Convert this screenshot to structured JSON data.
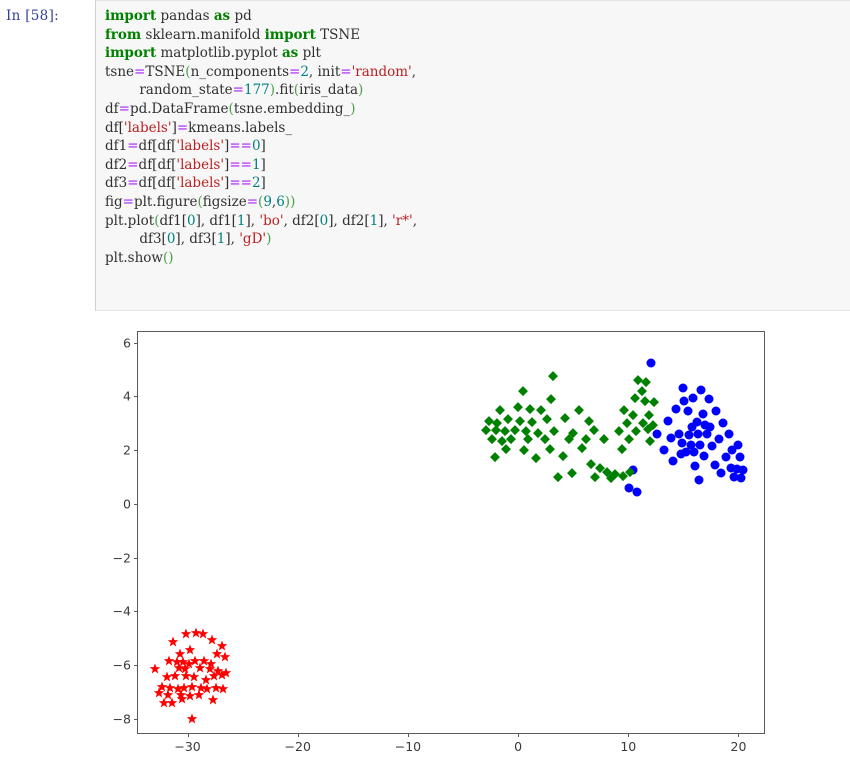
{
  "notebook": {
    "prompt": "In [58]:",
    "cell_type": "code",
    "code_lines": [
      [
        {
          "t": "import",
          "c": "kw"
        },
        {
          "t": " pandas ",
          "c": "pln"
        },
        {
          "t": "as",
          "c": "kw"
        },
        {
          "t": " pd",
          "c": "pln"
        }
      ],
      [
        {
          "t": "from",
          "c": "kw"
        },
        {
          "t": " sklearn.manifold ",
          "c": "pln"
        },
        {
          "t": "import",
          "c": "kw"
        },
        {
          "t": " TSNE",
          "c": "pln"
        }
      ],
      [
        {
          "t": "import",
          "c": "kw"
        },
        {
          "t": " matplotlib.pyplot ",
          "c": "pln"
        },
        {
          "t": "as",
          "c": "kw"
        },
        {
          "t": " plt",
          "c": "pln"
        }
      ],
      [
        {
          "t": "tsne",
          "c": "pln"
        },
        {
          "t": "=",
          "c": "op"
        },
        {
          "t": "TSNE",
          "c": "pln"
        },
        {
          "t": "(",
          "c": "par"
        },
        {
          "t": "n_components",
          "c": "pln"
        },
        {
          "t": "=",
          "c": "op"
        },
        {
          "t": "2",
          "c": "num"
        },
        {
          "t": ", init",
          "c": "pln"
        },
        {
          "t": "=",
          "c": "op"
        },
        {
          "t": "'random'",
          "c": "str"
        },
        {
          "t": ",",
          "c": "pln"
        }
      ],
      [
        {
          "t": "        random_state",
          "c": "pln"
        },
        {
          "t": "=",
          "c": "op"
        },
        {
          "t": "177",
          "c": "num"
        },
        {
          "t": ")",
          "c": "par"
        },
        {
          "t": ".fit",
          "c": "pln"
        },
        {
          "t": "(",
          "c": "par"
        },
        {
          "t": "iris_data",
          "c": "pln"
        },
        {
          "t": ")",
          "c": "par"
        }
      ],
      [
        {
          "t": "df",
          "c": "pln"
        },
        {
          "t": "=",
          "c": "op"
        },
        {
          "t": "pd.DataFrame",
          "c": "pln"
        },
        {
          "t": "(",
          "c": "par"
        },
        {
          "t": "tsne.embedding_",
          "c": "pln"
        },
        {
          "t": ")",
          "c": "par"
        }
      ],
      [
        {
          "t": "df[",
          "c": "pln"
        },
        {
          "t": "'labels'",
          "c": "str"
        },
        {
          "t": "]",
          "c": "pln"
        },
        {
          "t": "=",
          "c": "op"
        },
        {
          "t": "kmeans.labels_",
          "c": "pln"
        }
      ],
      [
        {
          "t": "df1",
          "c": "pln"
        },
        {
          "t": "=",
          "c": "op"
        },
        {
          "t": "df[df[",
          "c": "pln"
        },
        {
          "t": "'labels'",
          "c": "str"
        },
        {
          "t": "]",
          "c": "pln"
        },
        {
          "t": "==",
          "c": "op"
        },
        {
          "t": "0",
          "c": "num"
        },
        {
          "t": "]",
          "c": "pln"
        }
      ],
      [
        {
          "t": "df2",
          "c": "pln"
        },
        {
          "t": "=",
          "c": "op"
        },
        {
          "t": "df[df[",
          "c": "pln"
        },
        {
          "t": "'labels'",
          "c": "str"
        },
        {
          "t": "]",
          "c": "pln"
        },
        {
          "t": "==",
          "c": "op"
        },
        {
          "t": "1",
          "c": "num"
        },
        {
          "t": "]",
          "c": "pln"
        }
      ],
      [
        {
          "t": "df3",
          "c": "pln"
        },
        {
          "t": "=",
          "c": "op"
        },
        {
          "t": "df[df[",
          "c": "pln"
        },
        {
          "t": "'labels'",
          "c": "str"
        },
        {
          "t": "]",
          "c": "pln"
        },
        {
          "t": "==",
          "c": "op"
        },
        {
          "t": "2",
          "c": "num"
        },
        {
          "t": "]",
          "c": "pln"
        }
      ],
      [
        {
          "t": "fig",
          "c": "pln"
        },
        {
          "t": "=",
          "c": "op"
        },
        {
          "t": "plt.figure",
          "c": "pln"
        },
        {
          "t": "(",
          "c": "par"
        },
        {
          "t": "figsize",
          "c": "pln"
        },
        {
          "t": "=",
          "c": "op"
        },
        {
          "t": "(",
          "c": "par"
        },
        {
          "t": "9",
          "c": "num"
        },
        {
          "t": ",",
          "c": "pln"
        },
        {
          "t": "6",
          "c": "num"
        },
        {
          "t": ")",
          "c": "par"
        },
        {
          "t": ")",
          "c": "par"
        }
      ],
      [
        {
          "t": "plt.plot",
          "c": "pln"
        },
        {
          "t": "(",
          "c": "par"
        },
        {
          "t": "df1[",
          "c": "pln"
        },
        {
          "t": "0",
          "c": "num"
        },
        {
          "t": "], df1[",
          "c": "pln"
        },
        {
          "t": "1",
          "c": "num"
        },
        {
          "t": "], ",
          "c": "pln"
        },
        {
          "t": "'bo'",
          "c": "str"
        },
        {
          "t": ", df2[",
          "c": "pln"
        },
        {
          "t": "0",
          "c": "num"
        },
        {
          "t": "], df2[",
          "c": "pln"
        },
        {
          "t": "1",
          "c": "num"
        },
        {
          "t": "], ",
          "c": "pln"
        },
        {
          "t": "'r*'",
          "c": "str"
        },
        {
          "t": ",",
          "c": "pln"
        }
      ],
      [
        {
          "t": "        df3[",
          "c": "pln"
        },
        {
          "t": "0",
          "c": "num"
        },
        {
          "t": "], df3[",
          "c": "pln"
        },
        {
          "t": "1",
          "c": "num"
        },
        {
          "t": "], ",
          "c": "pln"
        },
        {
          "t": "'gD'",
          "c": "str"
        },
        {
          "t": ")",
          "c": "par"
        }
      ],
      [
        {
          "t": "plt.show",
          "c": "pln"
        },
        {
          "t": "(",
          "c": "par"
        },
        {
          "t": ")",
          "c": "par"
        }
      ]
    ]
  },
  "chart_data": {
    "type": "scatter",
    "title": "",
    "xlabel": "",
    "ylabel": "",
    "xlim": [
      -34.5,
      22.5
    ],
    "ylim": [
      -8.6,
      6.4
    ],
    "xticks": [
      -30,
      -20,
      -10,
      0,
      10,
      20
    ],
    "yticks": [
      -8,
      -6,
      -4,
      -2,
      0,
      2,
      4,
      6
    ],
    "xticklabels": [
      "−30",
      "−20",
      "−10",
      "0",
      "10",
      "20"
    ],
    "yticklabels": [
      "−8",
      "−6",
      "−4",
      "−2",
      "0",
      "2",
      "4",
      "6"
    ],
    "grid": false,
    "legend": null,
    "series": [
      {
        "name": "df1",
        "marker": "o",
        "marker_label": "bo",
        "color": "#0000FF",
        "size": 9,
        "points": [
          [
            12.1,
            5.25
          ],
          [
            15.0,
            4.3
          ],
          [
            16.6,
            4.25
          ],
          [
            15.9,
            3.95
          ],
          [
            17.3,
            3.9
          ],
          [
            14.3,
            3.55
          ],
          [
            15.4,
            3.45
          ],
          [
            18.0,
            3.45
          ],
          [
            13.6,
            3.1
          ],
          [
            16.2,
            3.05
          ],
          [
            17.0,
            2.95
          ],
          [
            16.8,
            3.35
          ],
          [
            12.6,
            2.6
          ],
          [
            14.6,
            2.6
          ],
          [
            15.5,
            2.55
          ],
          [
            16.3,
            2.6
          ],
          [
            17.1,
            2.6
          ],
          [
            19.1,
            2.6
          ],
          [
            14.9,
            2.25
          ],
          [
            15.7,
            2.2
          ],
          [
            16.5,
            2.2
          ],
          [
            15.2,
            1.95
          ],
          [
            16.0,
            1.95
          ],
          [
            17.6,
            2.15
          ],
          [
            18.9,
            1.75
          ],
          [
            20.1,
            1.75
          ],
          [
            14.1,
            1.6
          ],
          [
            17.9,
            1.45
          ],
          [
            19.3,
            1.35
          ],
          [
            19.9,
            1.3
          ],
          [
            20.4,
            1.25
          ],
          [
            19.6,
            1.0
          ],
          [
            20.2,
            0.95
          ],
          [
            18.4,
            1.15
          ],
          [
            10.4,
            1.25
          ],
          [
            10.1,
            0.6
          ],
          [
            10.8,
            0.45
          ],
          [
            16.9,
            1.8
          ],
          [
            15.8,
            2.85
          ],
          [
            13.9,
            2.45
          ],
          [
            17.4,
            2.85
          ],
          [
            18.2,
            2.4
          ],
          [
            19.4,
            2.0
          ],
          [
            16.1,
            1.4
          ],
          [
            14.8,
            1.85
          ],
          [
            20.0,
            2.2
          ],
          [
            18.6,
            3.0
          ],
          [
            15.1,
            3.85
          ],
          [
            13.2,
            2.0
          ],
          [
            16.4,
            0.9
          ]
        ]
      },
      {
        "name": "df2",
        "marker": "*",
        "marker_label": "r*",
        "color": "#FF0000",
        "size": 11,
        "points": [
          [
            -30.1,
            -4.85
          ],
          [
            -29.2,
            -4.8
          ],
          [
            -28.6,
            -4.85
          ],
          [
            -31.3,
            -5.15
          ],
          [
            -27.8,
            -5.05
          ],
          [
            -29.8,
            -5.45
          ],
          [
            -26.9,
            -5.3
          ],
          [
            -27.3,
            -5.6
          ],
          [
            -31.7,
            -5.85
          ],
          [
            -31.0,
            -5.9
          ],
          [
            -30.4,
            -5.9
          ],
          [
            -29.9,
            -5.95
          ],
          [
            -29.3,
            -5.85
          ],
          [
            -28.5,
            -5.85
          ],
          [
            -27.9,
            -5.95
          ],
          [
            -26.6,
            -5.7
          ],
          [
            -30.8,
            -6.1
          ],
          [
            -30.2,
            -6.15
          ],
          [
            -28.9,
            -6.1
          ],
          [
            -28.0,
            -6.15
          ],
          [
            -27.2,
            -6.2
          ],
          [
            -26.5,
            -6.3
          ],
          [
            -26.9,
            -6.35
          ],
          [
            -33.0,
            -6.15
          ],
          [
            -31.9,
            -6.45
          ],
          [
            -31.1,
            -6.4
          ],
          [
            -30.1,
            -6.4
          ],
          [
            -29.4,
            -6.45
          ],
          [
            -27.6,
            -6.4
          ],
          [
            -32.3,
            -6.8
          ],
          [
            -31.6,
            -6.85
          ],
          [
            -30.9,
            -6.9
          ],
          [
            -30.3,
            -6.85
          ],
          [
            -29.6,
            -6.8
          ],
          [
            -28.8,
            -6.85
          ],
          [
            -28.2,
            -6.9
          ],
          [
            -27.4,
            -6.85
          ],
          [
            -26.8,
            -6.9
          ],
          [
            -32.6,
            -7.05
          ],
          [
            -31.8,
            -7.1
          ],
          [
            -30.6,
            -7.1
          ],
          [
            -29.8,
            -7.15
          ],
          [
            -29.0,
            -7.1
          ],
          [
            -32.1,
            -7.4
          ],
          [
            -31.4,
            -7.4
          ],
          [
            -30.5,
            -7.25
          ],
          [
            -27.7,
            -7.3
          ],
          [
            -29.6,
            -8.0
          ],
          [
            -28.3,
            -6.55
          ],
          [
            -30.7,
            -5.6
          ]
        ]
      },
      {
        "name": "df3",
        "marker": "D",
        "marker_label": "gD",
        "color": "#008000",
        "size": 9,
        "points": [
          [
            3.2,
            4.75
          ],
          [
            10.9,
            4.6
          ],
          [
            11.6,
            4.55
          ],
          [
            0.4,
            4.2
          ],
          [
            11.2,
            4.2
          ],
          [
            10.6,
            3.95
          ],
          [
            11.5,
            3.85
          ],
          [
            12.3,
            3.8
          ],
          [
            -1.6,
            3.5
          ],
          [
            0.0,
            3.6
          ],
          [
            1.1,
            3.55
          ],
          [
            2.1,
            3.5
          ],
          [
            5.5,
            3.5
          ],
          [
            9.6,
            3.5
          ],
          [
            10.4,
            3.3
          ],
          [
            11.9,
            3.3
          ],
          [
            -2.6,
            3.1
          ],
          [
            -1.9,
            3.0
          ],
          [
            -0.9,
            3.15
          ],
          [
            0.2,
            3.1
          ],
          [
            1.3,
            3.05
          ],
          [
            2.6,
            3.15
          ],
          [
            4.3,
            3.2
          ],
          [
            6.4,
            3.1
          ],
          [
            9.9,
            3.0
          ],
          [
            11.3,
            3.0
          ],
          [
            -2.9,
            2.75
          ],
          [
            -2.0,
            2.75
          ],
          [
            -1.2,
            2.7
          ],
          [
            -0.3,
            2.75
          ],
          [
            0.7,
            2.7
          ],
          [
            1.8,
            2.65
          ],
          [
            3.3,
            2.7
          ],
          [
            5.0,
            2.65
          ],
          [
            6.9,
            2.75
          ],
          [
            9.2,
            2.7
          ],
          [
            10.7,
            2.7
          ],
          [
            11.8,
            2.8
          ],
          [
            -2.4,
            2.4
          ],
          [
            -1.5,
            2.35
          ],
          [
            -0.6,
            2.4
          ],
          [
            0.9,
            2.4
          ],
          [
            2.4,
            2.4
          ],
          [
            4.6,
            2.4
          ],
          [
            6.2,
            2.4
          ],
          [
            7.8,
            2.4
          ],
          [
            10.1,
            2.4
          ],
          [
            12.0,
            2.35
          ],
          [
            -1.1,
            2.05
          ],
          [
            0.5,
            2.0
          ],
          [
            2.9,
            2.05
          ],
          [
            5.8,
            2.1
          ],
          [
            9.4,
            2.05
          ],
          [
            -2.1,
            1.75
          ],
          [
            1.6,
            1.7
          ],
          [
            4.1,
            1.8
          ],
          [
            6.6,
            1.5
          ],
          [
            7.4,
            1.35
          ],
          [
            8.1,
            1.2
          ],
          [
            8.8,
            1.1
          ],
          [
            9.5,
            1.05
          ],
          [
            4.9,
            1.15
          ],
          [
            3.6,
            1.0
          ],
          [
            10.2,
            1.2
          ],
          [
            7.0,
            1.0
          ],
          [
            8.4,
            0.95
          ],
          [
            3.0,
            3.9
          ],
          [
            12.2,
            2.95
          ]
        ]
      }
    ]
  }
}
